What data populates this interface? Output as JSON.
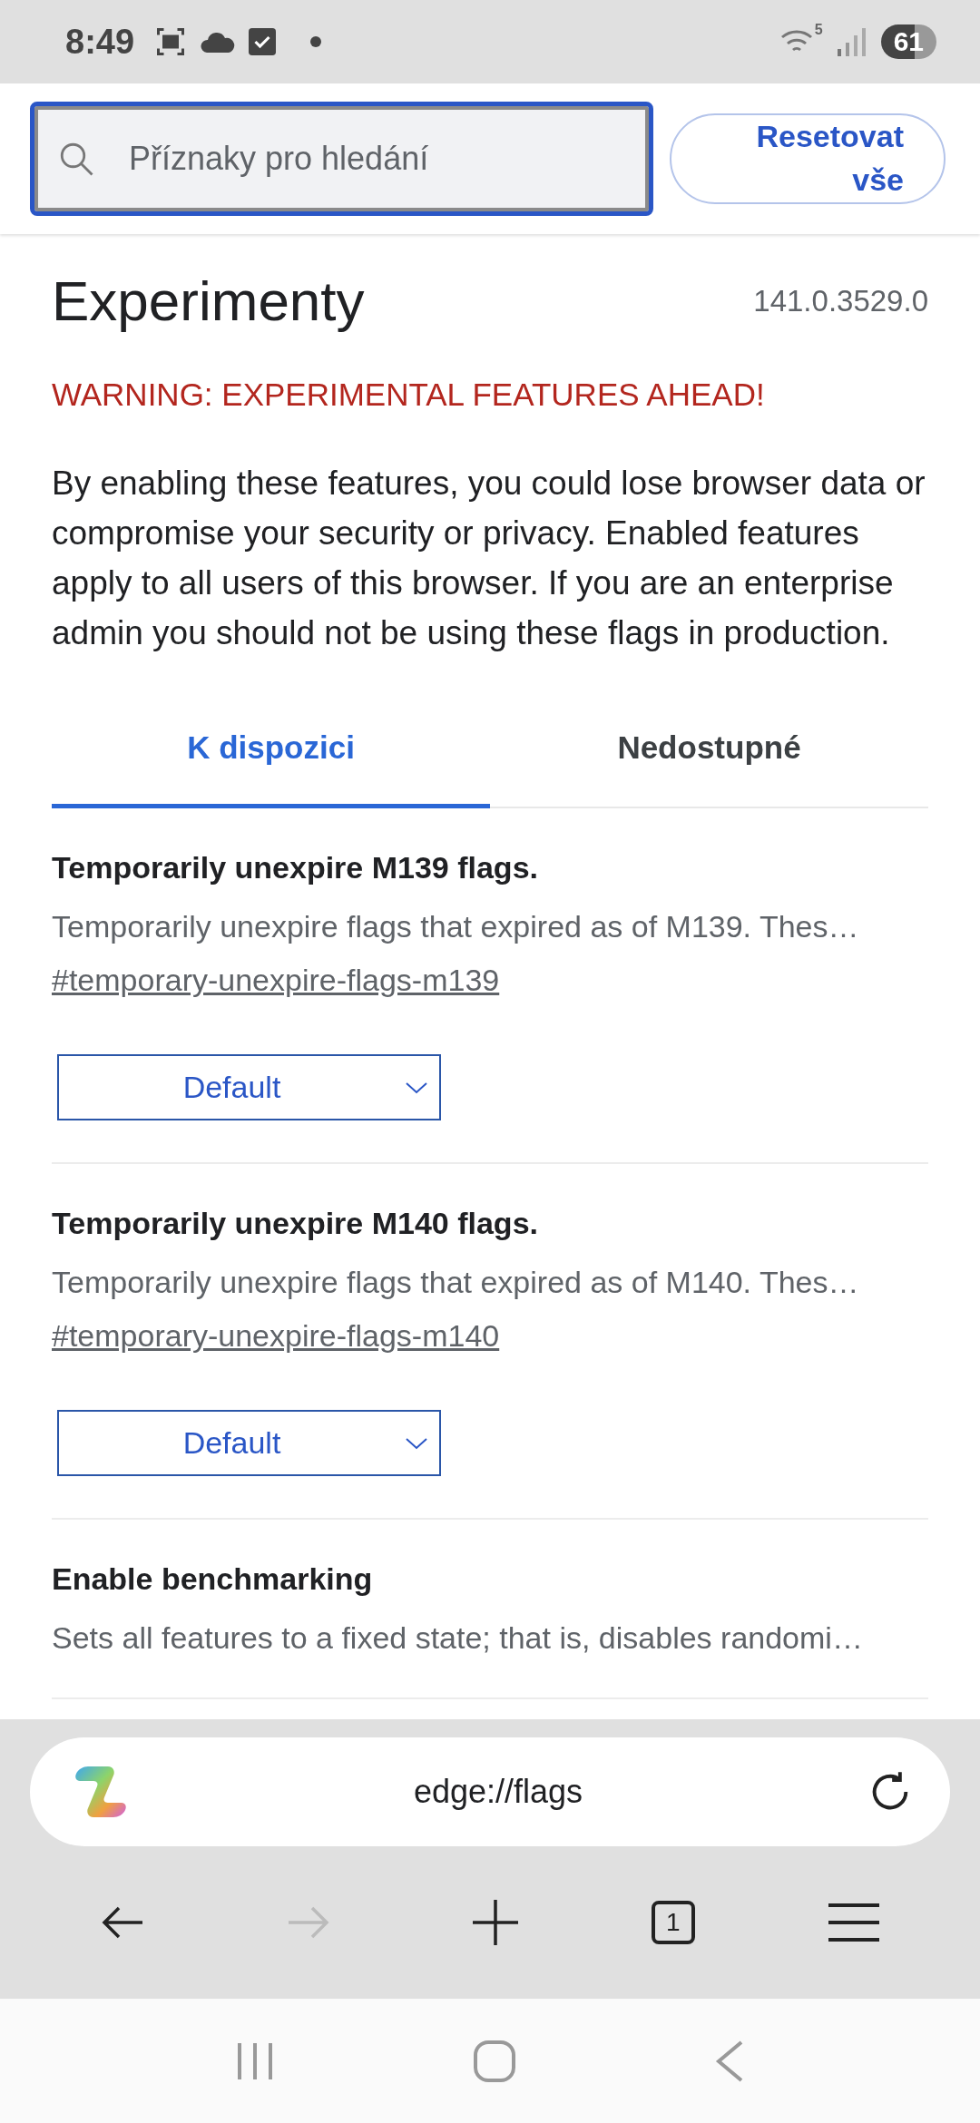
{
  "status_bar": {
    "time": "8:49",
    "wifi_band": "5",
    "battery": "61"
  },
  "search": {
    "placeholder": "Příznaky pro hledání"
  },
  "reset_button": "Resetovat vše",
  "page": {
    "title": "Experimenty",
    "version": "141.0.3529.0",
    "warning": "WARNING: EXPERIMENTAL FEATURES AHEAD!",
    "intro": "By enabling these features, you could lose browser data or compromise your security or privacy. Enabled features apply to all users of this browser. If you are an enterprise admin you should not be using these flags in production."
  },
  "tabs": [
    {
      "label": "K dispozici",
      "selected": true
    },
    {
      "label": "Nedostupné",
      "selected": false
    }
  ],
  "flags": [
    {
      "title": "Temporarily unexpire M139 flags.",
      "description": "Temporarily unexpire flags that expired as of M139. Thes…",
      "link": "#temporary-unexpire-flags-m139",
      "value": "Default"
    },
    {
      "title": "Temporarily unexpire M140 flags.",
      "description": "Temporarily unexpire flags that expired as of M140. Thes…",
      "link": "#temporary-unexpire-flags-m140",
      "value": "Default"
    },
    {
      "title": "Enable benchmarking",
      "description": "Sets all features to a fixed state; that is, disables randomi…"
    }
  ],
  "address_bar": {
    "url": "edge://flags"
  },
  "toolbar": {
    "tab_count": "1",
    "forward_disabled": true
  }
}
